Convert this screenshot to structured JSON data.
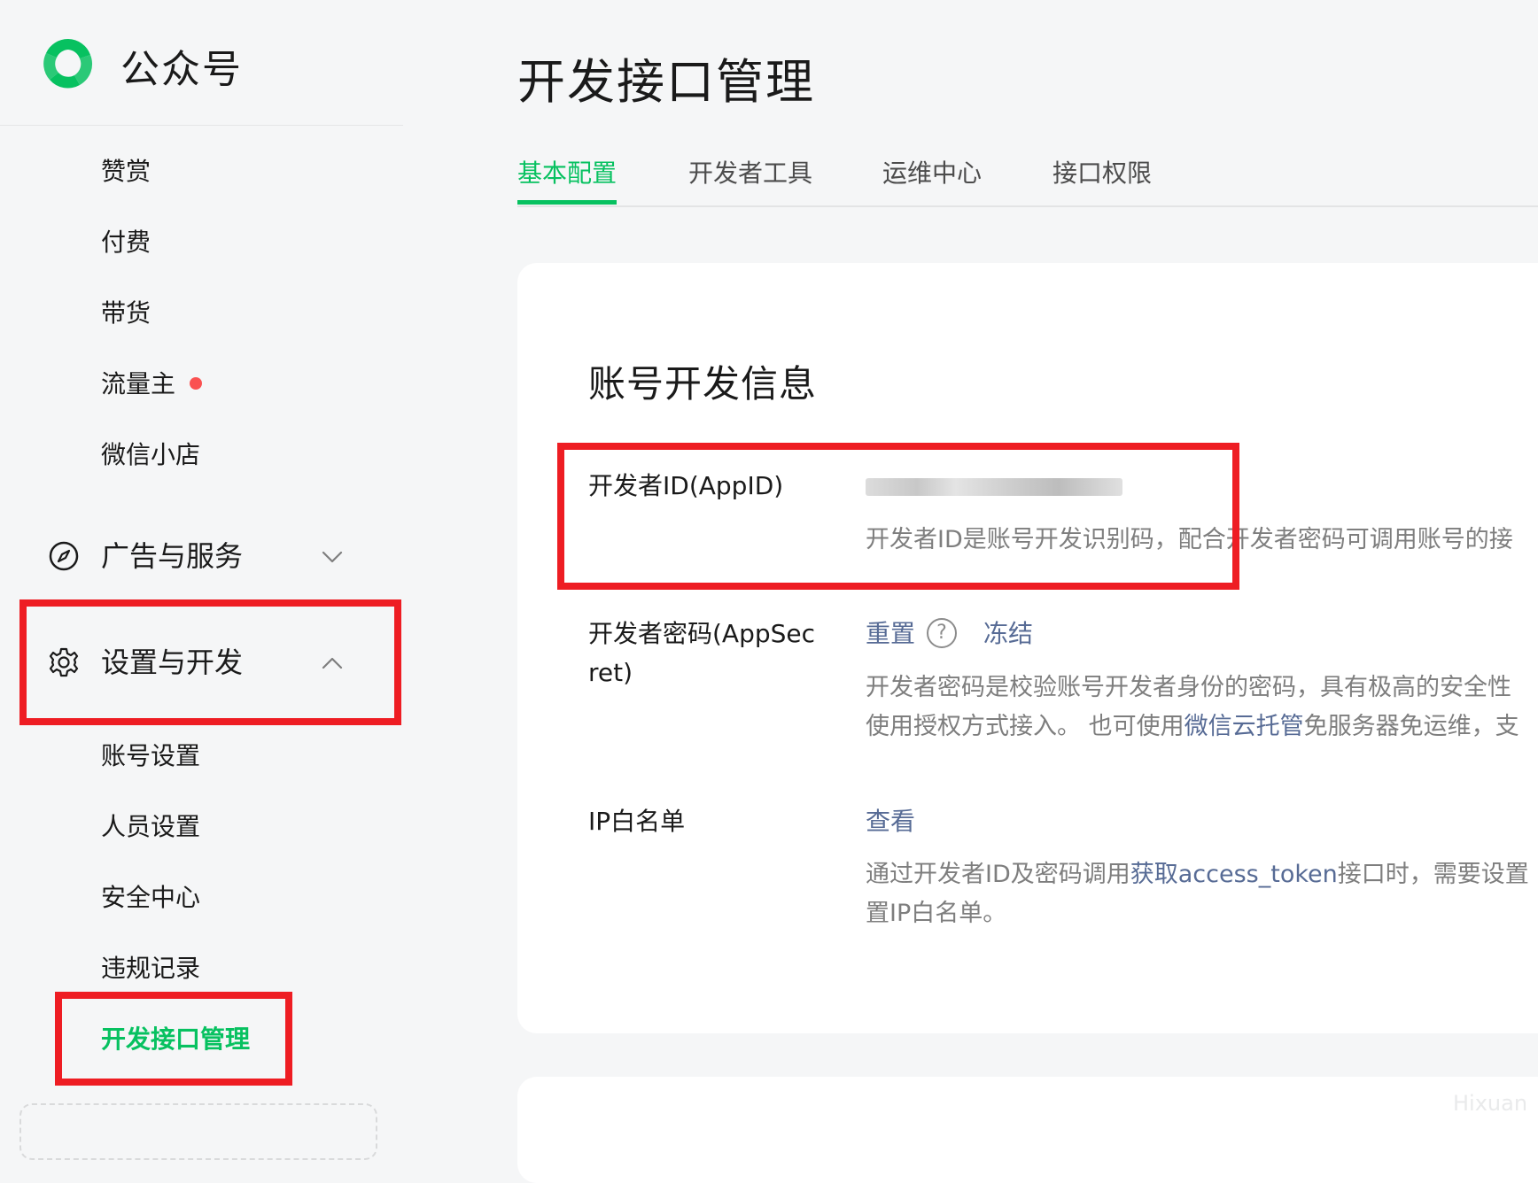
{
  "brand": {
    "name": "公众号",
    "accent_color": "#07c160",
    "link_color": "#576b95",
    "highlight_color": "#ee1d23"
  },
  "sidebar": {
    "items_top": [
      {
        "label": "赞赏"
      },
      {
        "label": "付费"
      },
      {
        "label": "带货"
      },
      {
        "label": "流量主",
        "badge": "red-dot"
      },
      {
        "label": "微信小店"
      }
    ],
    "groups": [
      {
        "label": "广告与服务",
        "icon": "compass-icon",
        "expanded": false
      },
      {
        "label": "设置与开发",
        "icon": "gear-icon",
        "expanded": true
      }
    ],
    "items_settings": [
      {
        "label": "账号设置"
      },
      {
        "label": "人员设置"
      },
      {
        "label": "安全中心"
      },
      {
        "label": "违规记录"
      },
      {
        "label": "开发接口管理",
        "active": true
      }
    ]
  },
  "main": {
    "title": "开发接口管理",
    "tabs": [
      {
        "label": "基本配置",
        "active": true
      },
      {
        "label": "开发者工具"
      },
      {
        "label": "运维中心"
      },
      {
        "label": "接口权限"
      }
    ],
    "section_title": "账号开发信息",
    "fields": {
      "appid": {
        "label": "开发者ID(AppID)",
        "value": "",
        "desc": "开发者ID是账号开发识别码，配合开发者密码可调用账号的接"
      },
      "secret": {
        "label_line1": "开发者密码(AppSec",
        "label_line2": "ret)",
        "action_reset": "重置",
        "help_glyph": "?",
        "action_freeze": "冻结",
        "desc_line1": "开发者密码是校验账号开发者身份的密码，具有极高的安全性",
        "desc_line2_a": "使用授权方式接入。 也可使用",
        "desc_line2_link": "微信云托管",
        "desc_line2_b": "免服务器免运维，支"
      },
      "ip_whitelist": {
        "label": "IP白名单",
        "action_view": "查看",
        "desc_line1_a": "通过开发者ID及密码调用",
        "desc_line1_link": "获取access_token",
        "desc_line1_b": "接口时，需要设置",
        "desc_line2": "置IP白名单。"
      }
    }
  },
  "watermark": "Hixuan"
}
